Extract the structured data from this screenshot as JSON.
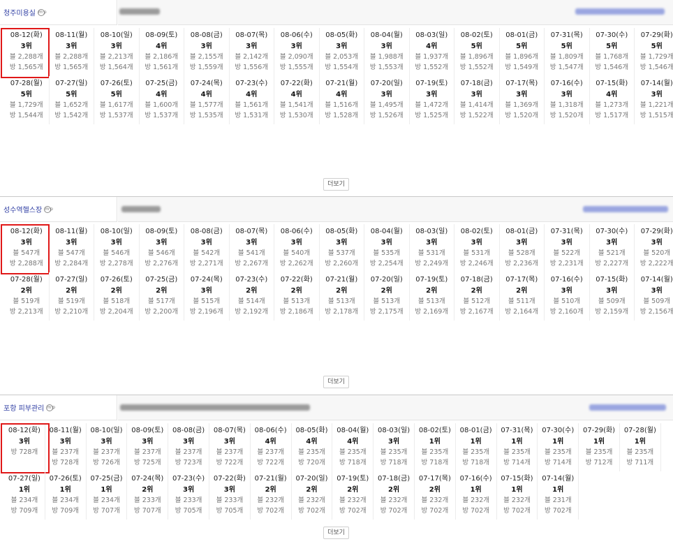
{
  "ui": {
    "more_label": "더보기",
    "badge_text": "m·p"
  },
  "colors": {
    "highlight": "#e01818",
    "link": "#2f3ea3"
  },
  "sections": [
    {
      "name": "청주미용실",
      "entries": [
        {
          "date": "08-12(화)",
          "rank": "3위",
          "blog": "블 2,288개",
          "room": "방 1,565개"
        },
        {
          "date": "08-11(월)",
          "rank": "3위",
          "blog": "블 2,288개",
          "room": "방 1,565개"
        },
        {
          "date": "08-10(일)",
          "rank": "3위",
          "blog": "블 2,213개",
          "room": "방 1,564개"
        },
        {
          "date": "08-09(토)",
          "rank": "4위",
          "blog": "블 2,186개",
          "room": "방 1,561개"
        },
        {
          "date": "08-08(금)",
          "rank": "3위",
          "blog": "블 2,155개",
          "room": "방 1,559개"
        },
        {
          "date": "08-07(목)",
          "rank": "3위",
          "blog": "블 2,142개",
          "room": "방 1,556개"
        },
        {
          "date": "08-06(수)",
          "rank": "3위",
          "blog": "블 2,090개",
          "room": "방 1,555개"
        },
        {
          "date": "08-05(화)",
          "rank": "3위",
          "blog": "블 2,053개",
          "room": "방 1,554개"
        },
        {
          "date": "08-04(월)",
          "rank": "3위",
          "blog": "블 1,988개",
          "room": "방 1,553개"
        },
        {
          "date": "08-03(일)",
          "rank": "4위",
          "blog": "블 1,937개",
          "room": "방 1,552개"
        },
        {
          "date": "08-02(토)",
          "rank": "5위",
          "blog": "블 1,896개",
          "room": "방 1,552개"
        },
        {
          "date": "08-01(금)",
          "rank": "5위",
          "blog": "블 1,896개",
          "room": "방 1,549개"
        },
        {
          "date": "07-31(목)",
          "rank": "5위",
          "blog": "블 1,809개",
          "room": "방 1,547개"
        },
        {
          "date": "07-30(수)",
          "rank": "5위",
          "blog": "블 1,768개",
          "room": "방 1,546개"
        },
        {
          "date": "07-29(화)",
          "rank": "5위",
          "blog": "블 1,729개",
          "room": "방 1,546개"
        },
        {
          "date": "07-28(월)",
          "rank": "5위",
          "blog": "블 1,729개",
          "room": "방 1,544개"
        },
        {
          "date": "07-27(일)",
          "rank": "5위",
          "blog": "블 1,652개",
          "room": "방 1,542개"
        },
        {
          "date": "07-26(토)",
          "rank": "5위",
          "blog": "블 1,617개",
          "room": "방 1,537개"
        },
        {
          "date": "07-25(금)",
          "rank": "4위",
          "blog": "블 1,600개",
          "room": "방 1,537개"
        },
        {
          "date": "07-24(목)",
          "rank": "4위",
          "blog": "블 1,577개",
          "room": "방 1,535개"
        },
        {
          "date": "07-23(수)",
          "rank": "4위",
          "blog": "블 1,561개",
          "room": "방 1,531개"
        },
        {
          "date": "07-22(화)",
          "rank": "4위",
          "blog": "블 1,541개",
          "room": "방 1,530개"
        },
        {
          "date": "07-21(월)",
          "rank": "4위",
          "blog": "블 1,516개",
          "room": "방 1,528개"
        },
        {
          "date": "07-20(일)",
          "rank": "3위",
          "blog": "블 1,495개",
          "room": "방 1,526개"
        },
        {
          "date": "07-19(토)",
          "rank": "3위",
          "blog": "블 1,472개",
          "room": "방 1,525개"
        },
        {
          "date": "07-18(금)",
          "rank": "3위",
          "blog": "블 1,414개",
          "room": "방 1,522개"
        },
        {
          "date": "07-17(목)",
          "rank": "3위",
          "blog": "블 1,369개",
          "room": "방 1,520개"
        },
        {
          "date": "07-16(수)",
          "rank": "3위",
          "blog": "블 1,318개",
          "room": "방 1,520개"
        },
        {
          "date": "07-15(화)",
          "rank": "4위",
          "blog": "블 1,273개",
          "room": "방 1,517개"
        },
        {
          "date": "07-14(월)",
          "rank": "3위",
          "blog": "블 1,221개",
          "room": "방 1,515개"
        }
      ]
    },
    {
      "name": "성수역헬스장",
      "entries": [
        {
          "date": "08-12(화)",
          "rank": "3위",
          "blog": "블 547개",
          "room": "방 2,288개"
        },
        {
          "date": "08-11(월)",
          "rank": "3위",
          "blog": "블 547개",
          "room": "방 2,284개"
        },
        {
          "date": "08-10(일)",
          "rank": "3위",
          "blog": "블 546개",
          "room": "방 2,278개"
        },
        {
          "date": "08-09(토)",
          "rank": "3위",
          "blog": "블 546개",
          "room": "방 2,276개"
        },
        {
          "date": "08-08(금)",
          "rank": "3위",
          "blog": "블 542개",
          "room": "방 2,271개"
        },
        {
          "date": "08-07(목)",
          "rank": "3위",
          "blog": "블 541개",
          "room": "방 2,267개"
        },
        {
          "date": "08-06(수)",
          "rank": "3위",
          "blog": "블 540개",
          "room": "방 2,262개"
        },
        {
          "date": "08-05(화)",
          "rank": "3위",
          "blog": "블 537개",
          "room": "방 2,260개"
        },
        {
          "date": "08-04(월)",
          "rank": "3위",
          "blog": "블 535개",
          "room": "방 2,254개"
        },
        {
          "date": "08-03(일)",
          "rank": "3위",
          "blog": "블 531개",
          "room": "방 2,249개"
        },
        {
          "date": "08-02(토)",
          "rank": "3위",
          "blog": "블 531개",
          "room": "방 2,246개"
        },
        {
          "date": "08-01(금)",
          "rank": "3위",
          "blog": "블 528개",
          "room": "방 2,236개"
        },
        {
          "date": "07-31(목)",
          "rank": "3위",
          "blog": "블 522개",
          "room": "방 2,231개"
        },
        {
          "date": "07-30(수)",
          "rank": "3위",
          "blog": "블 521개",
          "room": "방 2,227개"
        },
        {
          "date": "07-29(화)",
          "rank": "3위",
          "blog": "블 520개",
          "room": "방 2,222개"
        },
        {
          "date": "07-28(월)",
          "rank": "2위",
          "blog": "블 519개",
          "room": "방 2,213개"
        },
        {
          "date": "07-27(일)",
          "rank": "2위",
          "blog": "블 519개",
          "room": "방 2,210개"
        },
        {
          "date": "07-26(토)",
          "rank": "2위",
          "blog": "블 518개",
          "room": "방 2,204개"
        },
        {
          "date": "07-25(금)",
          "rank": "2위",
          "blog": "블 517개",
          "room": "방 2,200개"
        },
        {
          "date": "07-24(목)",
          "rank": "3위",
          "blog": "블 515개",
          "room": "방 2,196개"
        },
        {
          "date": "07-23(수)",
          "rank": "2위",
          "blog": "블 514개",
          "room": "방 2,192개"
        },
        {
          "date": "07-22(화)",
          "rank": "2위",
          "blog": "블 513개",
          "room": "방 2,186개"
        },
        {
          "date": "07-21(월)",
          "rank": "2위",
          "blog": "블 513개",
          "room": "방 2,178개"
        },
        {
          "date": "07-20(일)",
          "rank": "2위",
          "blog": "블 513개",
          "room": "방 2,175개"
        },
        {
          "date": "07-19(토)",
          "rank": "2위",
          "blog": "블 513개",
          "room": "방 2,169개"
        },
        {
          "date": "07-18(금)",
          "rank": "2위",
          "blog": "블 512개",
          "room": "방 2,167개"
        },
        {
          "date": "07-17(목)",
          "rank": "2위",
          "blog": "블 511개",
          "room": "방 2,164개"
        },
        {
          "date": "07-16(수)",
          "rank": "3위",
          "blog": "블 510개",
          "room": "방 2,160개"
        },
        {
          "date": "07-15(화)",
          "rank": "3위",
          "blog": "블 509개",
          "room": "방 2,159개"
        },
        {
          "date": "07-14(월)",
          "rank": "3위",
          "blog": "블 509개",
          "room": "방 2,156개"
        }
      ]
    },
    {
      "name": "포항 피부관리",
      "entries": [
        {
          "date": "08-12(화)",
          "rank": "3위",
          "blog": "",
          "room": "방 728개"
        },
        {
          "date": "08-11(월)",
          "rank": "3위",
          "blog": "블 237개",
          "room": "방 728개"
        },
        {
          "date": "08-10(일)",
          "rank": "3위",
          "blog": "블 237개",
          "room": "방 726개"
        },
        {
          "date": "08-09(토)",
          "rank": "3위",
          "blog": "블 237개",
          "room": "방 725개"
        },
        {
          "date": "08-08(금)",
          "rank": "3위",
          "blog": "블 237개",
          "room": "방 723개"
        },
        {
          "date": "08-07(목)",
          "rank": "3위",
          "blog": "블 237개",
          "room": "방 722개"
        },
        {
          "date": "08-06(수)",
          "rank": "4위",
          "blog": "블 237개",
          "room": "방 722개"
        },
        {
          "date": "08-05(화)",
          "rank": "4위",
          "blog": "블 235개",
          "room": "방 720개"
        },
        {
          "date": "08-04(월)",
          "rank": "4위",
          "blog": "블 235개",
          "room": "방 718개"
        },
        {
          "date": "08-03(일)",
          "rank": "3위",
          "blog": "블 235개",
          "room": "방 718개"
        },
        {
          "date": "08-02(토)",
          "rank": "1위",
          "blog": "블 235개",
          "room": "방 718개"
        },
        {
          "date": "08-01(금)",
          "rank": "1위",
          "blog": "블 235개",
          "room": "방 718개"
        },
        {
          "date": "07-31(목)",
          "rank": "1위",
          "blog": "블 235개",
          "room": "방 714개"
        },
        {
          "date": "07-30(수)",
          "rank": "1위",
          "blog": "블 235개",
          "room": "방 714개"
        },
        {
          "date": "07-29(화)",
          "rank": "1위",
          "blog": "블 235개",
          "room": "방 712개"
        },
        {
          "date": "07-28(월)",
          "rank": "1위",
          "blog": "블 235개",
          "room": "방 711개"
        },
        {
          "date": "07-27(일)",
          "rank": "1위",
          "blog": "블 234개",
          "room": "방 709개"
        },
        {
          "date": "07-26(토)",
          "rank": "1위",
          "blog": "블 234개",
          "room": "방 709개"
        },
        {
          "date": "07-25(금)",
          "rank": "1위",
          "blog": "블 234개",
          "room": "방 707개"
        },
        {
          "date": "07-24(목)",
          "rank": "2위",
          "blog": "블 233개",
          "room": "방 707개"
        },
        {
          "date": "07-23(수)",
          "rank": "3위",
          "blog": "블 233개",
          "room": "방 705개"
        },
        {
          "date": "07-22(화)",
          "rank": "3위",
          "blog": "블 233개",
          "room": "방 705개"
        },
        {
          "date": "07-21(월)",
          "rank": "2위",
          "blog": "블 232개",
          "room": "방 702개"
        },
        {
          "date": "07-20(일)",
          "rank": "2위",
          "blog": "블 232개",
          "room": "방 702개"
        },
        {
          "date": "07-19(토)",
          "rank": "2위",
          "blog": "블 232개",
          "room": "방 702개"
        },
        {
          "date": "07-18(금)",
          "rank": "2위",
          "blog": "블 232개",
          "room": "방 702개"
        },
        {
          "date": "07-17(목)",
          "rank": "2위",
          "blog": "블 232개",
          "room": "방 702개"
        },
        {
          "date": "07-16(수)",
          "rank": "1위",
          "blog": "블 232개",
          "room": "방 702개"
        },
        {
          "date": "07-15(화)",
          "rank": "1위",
          "blog": "블 232개",
          "room": "방 702개"
        },
        {
          "date": "07-14(월)",
          "rank": "1위",
          "blog": "블 231개",
          "room": "방 702개"
        }
      ]
    }
  ]
}
